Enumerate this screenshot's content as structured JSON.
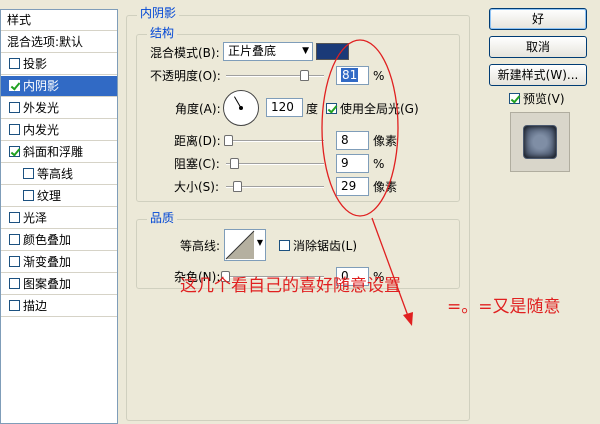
{
  "sidebar": {
    "header": "样式",
    "blending_default": "混合选项:默认",
    "items": [
      {
        "label": "投影",
        "checked": false
      },
      {
        "label": "内阴影",
        "checked": true
      },
      {
        "label": "外发光",
        "checked": false
      },
      {
        "label": "内发光",
        "checked": false
      },
      {
        "label": "斜面和浮雕",
        "checked": true
      },
      {
        "label": "等高线",
        "checked": false
      },
      {
        "label": "纹理",
        "checked": false
      },
      {
        "label": "光泽",
        "checked": false
      },
      {
        "label": "颜色叠加",
        "checked": false
      },
      {
        "label": "渐变叠加",
        "checked": false
      },
      {
        "label": "图案叠加",
        "checked": false
      },
      {
        "label": "描边",
        "checked": false
      }
    ]
  },
  "panel": {
    "title": "内阴影",
    "structure": {
      "title": "结构",
      "blend_mode_label": "混合模式(B):",
      "blend_mode_value": "正片叠底",
      "color": "#1a3a78",
      "opacity_label": "不透明度(O):",
      "opacity_value": "81",
      "opacity_unit": "%",
      "opacity_level": 81,
      "angle_label": "角度(A):",
      "angle_value": "120",
      "angle_unit": "度",
      "global_light_label": "使用全局光(G)",
      "global_light_checked": true,
      "distance_label": "距离(D):",
      "distance_value": "8",
      "distance_unit": "像素",
      "distance_level": 0.03,
      "choke_label": "阻塞(C):",
      "choke_value": "9",
      "choke_unit": "%",
      "choke_level": 9,
      "size_label": "大小(S):",
      "size_value": "29",
      "size_unit": "像素",
      "size_level": 0.12
    },
    "quality": {
      "title": "品质",
      "contour_label": "等高线:",
      "antialias_label": "消除锯齿(L)",
      "antialias_checked": false,
      "noise_label": "杂色(N):",
      "noise_value": "0",
      "noise_unit": "%",
      "noise_level": 0
    }
  },
  "buttons": {
    "ok": "好",
    "cancel": "取消",
    "new_style": "新建样式(W)...",
    "preview_label": "预览(V)",
    "preview_checked": true
  },
  "annotations": {
    "note1": "这几个看自己的喜好随意设置",
    "note2": "=。=又是随意"
  }
}
